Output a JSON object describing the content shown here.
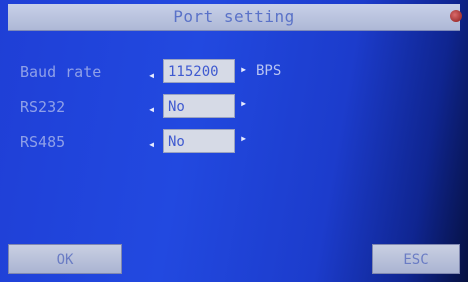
{
  "window": {
    "title": "Port setting"
  },
  "settings": [
    {
      "label": "Baud rate",
      "value": "115200",
      "unit": "BPS"
    },
    {
      "label": "RS232",
      "value": "No"
    },
    {
      "label": "RS485",
      "value": "No"
    }
  ],
  "buttons": {
    "ok": "OK",
    "esc": "ESC"
  },
  "icons": {
    "close": "close-icon",
    "left": "arrow-left-icon",
    "right": "arrow-right-icon"
  },
  "colors": {
    "background": "#2249e0",
    "titlebar": "#c8d0e8",
    "label_text": "#8fa0e8",
    "field_bg": "#d6dae6",
    "field_text": "#3f5ad0"
  }
}
